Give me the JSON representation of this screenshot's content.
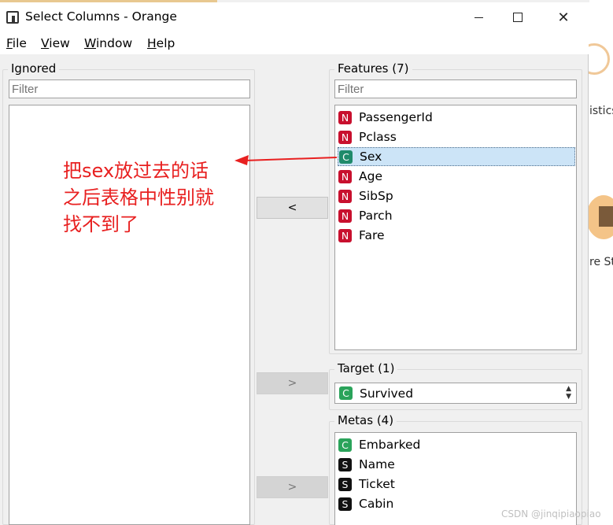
{
  "window": {
    "title": "Select Columns - Orange",
    "minimize": "",
    "maximize": "",
    "close": "✕"
  },
  "menu": [
    {
      "label": "File",
      "mnemonic": "F",
      "rest": "ile"
    },
    {
      "label": "View",
      "mnemonic": "V",
      "rest": "iew"
    },
    {
      "label": "Window",
      "mnemonic": "W",
      "rest": "indow"
    },
    {
      "label": "Help",
      "mnemonic": "H",
      "rest": "elp"
    }
  ],
  "ignored": {
    "title": "Ignored",
    "filter_placeholder": "Filter",
    "items": []
  },
  "features": {
    "title": "Features (7)",
    "filter_placeholder": "Filter",
    "items": [
      {
        "type": "N",
        "name": "PassengerId"
      },
      {
        "type": "N",
        "name": "Pclass"
      },
      {
        "type": "C",
        "name": "Sex",
        "selected": true
      },
      {
        "type": "N",
        "name": "Age"
      },
      {
        "type": "N",
        "name": "SibSp"
      },
      {
        "type": "N",
        "name": "Parch"
      },
      {
        "type": "N",
        "name": "Fare"
      }
    ]
  },
  "target": {
    "title": "Target (1)",
    "selected": {
      "type": "C",
      "name": "Survived"
    }
  },
  "metas": {
    "title": "Metas (4)",
    "items": [
      {
        "type": "C",
        "name": "Embarked"
      },
      {
        "type": "S",
        "name": "Name"
      },
      {
        "type": "S",
        "name": "Ticket"
      },
      {
        "type": "S",
        "name": "Cabin"
      }
    ]
  },
  "buttons": {
    "to_ignored": "<",
    "to_target": ">",
    "to_metas": ">"
  },
  "annotation": {
    "lines": [
      "把sex放过去的话",
      "之后表格中性别就",
      "找不到了"
    ],
    "color": "#e82020"
  },
  "background": {
    "label1": "istics",
    "label2": "re St"
  },
  "watermark": "CSDN @jinqipiaopiao"
}
